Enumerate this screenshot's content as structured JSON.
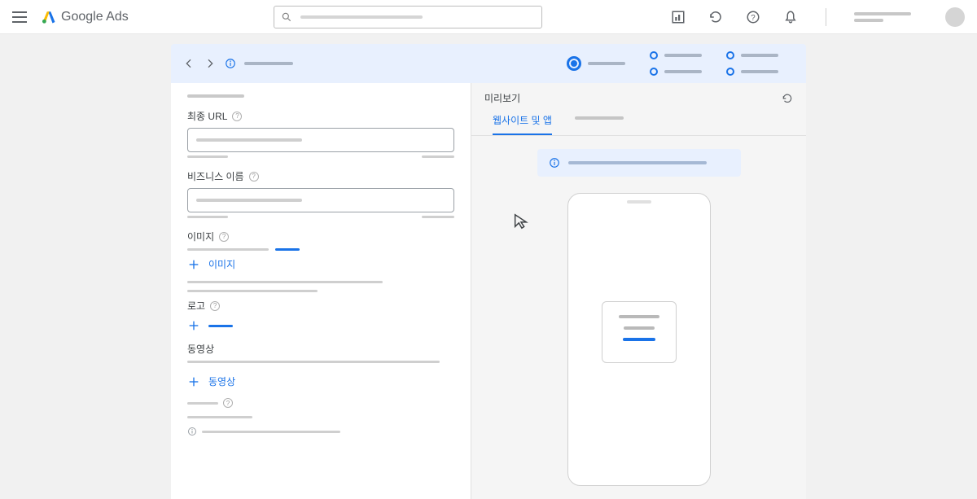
{
  "header": {
    "logo_text_bold": "Google",
    "logo_text": "Ads"
  },
  "form": {
    "final_url_label": "최종 URL",
    "business_name_label": "비즈니스 이름",
    "image_label": "이미지",
    "add_image_label": "이미지",
    "logo_label": "로고",
    "video_label": "동영상",
    "add_video_label": "동영상"
  },
  "preview": {
    "title": "미리보기",
    "tab_active": "웹사이트 및 앱"
  }
}
